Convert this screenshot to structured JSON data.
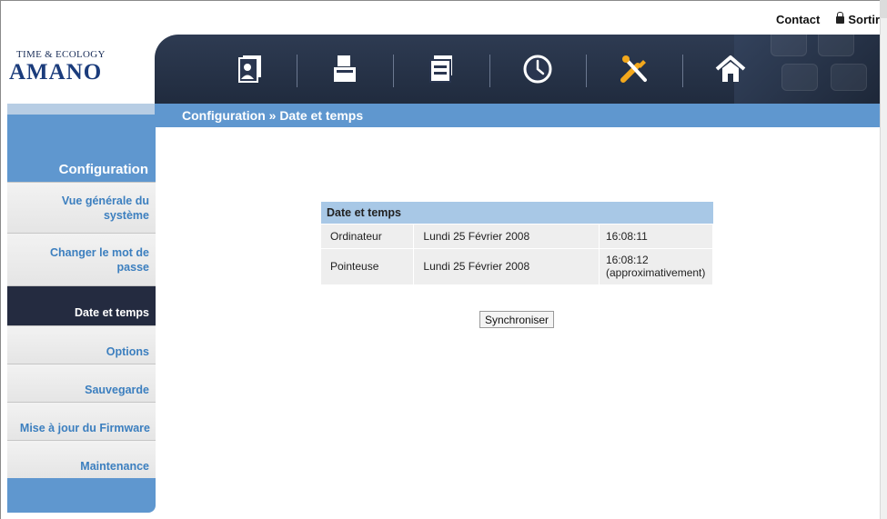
{
  "header": {
    "contact_label": "Contact",
    "logout_label": "Sortir",
    "logo_tagline": "TIME & ECOLOGY",
    "logo_brand": "AMANO"
  },
  "nav_icons": [
    {
      "name": "employee-card-icon"
    },
    {
      "name": "time-card-icon"
    },
    {
      "name": "terminal-icon"
    },
    {
      "name": "clock-icon"
    },
    {
      "name": "tools-icon"
    },
    {
      "name": "home-icon"
    }
  ],
  "breadcrumb": "Configuration » Date et temps",
  "sidebar": {
    "title": "Configuration",
    "items": [
      {
        "label": "Vue générale du système",
        "line1": "Vue générale du",
        "line2": "système"
      },
      {
        "label": "Changer le mot de passe",
        "line1": "Changer le mot de",
        "line2": "passe"
      },
      {
        "label": "Date et temps",
        "active": true
      },
      {
        "label": "Options"
      },
      {
        "label": "Sauvegarde"
      },
      {
        "label": "Mise à jour du Firmware"
      },
      {
        "label": "Maintenance"
      }
    ]
  },
  "datetime_table": {
    "title": "Date et temps",
    "rows": [
      {
        "source": "Ordinateur",
        "date": "Lundi 25 Février 2008",
        "time": "16:08:11",
        "note": ""
      },
      {
        "source": "Pointeuse",
        "date": "Lundi 25 Février 2008",
        "time": "16:08:12",
        "note": "(approximativement)"
      }
    ]
  },
  "sync_button": "Synchroniser",
  "colors": {
    "banner": "#202b3e",
    "accent_blue": "#5f97cf",
    "table_header": "#a8c8e6",
    "active_item": "#242b40",
    "link_blue": "#3c7fbf"
  }
}
